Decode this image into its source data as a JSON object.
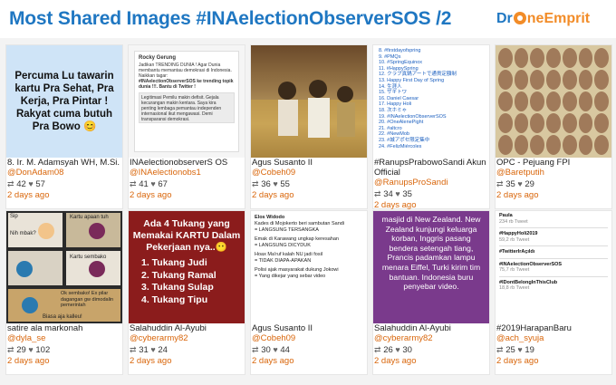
{
  "title": "Most Shared Images #INAelectionObserverSOS /2",
  "logo": {
    "pre": "Dr",
    "post": "neEmprit"
  },
  "items": [
    {
      "name": "8. Ir. M. Adamsyah WH, M.Si.",
      "handle": "@DonAdam08",
      "retweets": "42",
      "likes": "57",
      "ago": "2 days ago",
      "image_text": "Percuma Lu tawarin kartu Pra Sehat, Pra Kerja, Pra Pintar ! Rakyat cuma butuh Pra Bowo 😊"
    },
    {
      "name": "INAelectionobserverS OS",
      "handle": "@INAelectionobs1",
      "retweets": "41",
      "likes": "67",
      "ago": "2 days ago",
      "image_lines": [
        "Rocky Gerung",
        "Jadikan TRENDING DUNIA ! Agar Dunia membantu memantau demokrasi di Indonesia. Naikkan tagar:",
        "#INAelectionObserverSOS ke trending topik dunia !!!. Bantu di Twitter !",
        "Legitimasi Pemilu makin defisit. Gejala kecurangan makin kentara. Saya kira penting lembaga pemantau independen internasional ikut mengawasi. Demi transparansi demokrasi."
      ]
    },
    {
      "name": "Agus Susanto II",
      "handle": "@Cobeh09",
      "retweets": "36",
      "likes": "55",
      "ago": "2 days ago"
    },
    {
      "name": "#RanupsPrabowoSandi Akun",
      "name2": "Official",
      "handle": "@RanupsProSandi",
      "retweets": "34",
      "likes": "35",
      "ago": "2 days ago",
      "image_lines": [
        "8. #firstdayofspring",
        "9. #PMQs",
        "10. #SpringEquinox",
        "11. #HappySpring",
        "12. クラブ真鍋アートで通貨定額制",
        "13. Happy First Day of Spring",
        "14. 生涯人",
        "15. ザギトワ",
        "16. Daniel Caesar",
        "17. Happy Holi",
        "18. 次ホミゃ",
        "19. #INAelectionObserverSOS",
        "20. #OneAlenePight",
        "21. #altcro",
        "22. #NewMob",
        "23. #城アポセ限定集中",
        "24. #FelizMiércoles"
      ]
    },
    {
      "name": "OPC - Pejuang FPI",
      "handle": "@Baretputih",
      "retweets": "35",
      "likes": "29",
      "ago": "2 days ago"
    },
    {
      "name": "satire ala markonah",
      "handle": "@dyla_se",
      "retweets": "29",
      "likes": "102",
      "ago": "2 days ago",
      "image_lines": [
        "Sip",
        "Nih mbak?",
        "Kartu apaan tuh",
        "Kartu sembako",
        "Ok sembako! Ex pilar dagangan gw dimodalin pemerintah",
        "Biasa aja kalleu!"
      ]
    },
    {
      "name": "Salahuddin Al-Ayubi",
      "handle": "@cyberarmy82",
      "retweets": "31",
      "likes": "24",
      "ago": "2 days ago",
      "image_title": "Ada 4 Tukang yang Memakai KARTU Dalam Pekerjaan nya..😶",
      "image_lines": [
        "1. Tukang Judi",
        "2. Tukang Ramal",
        "3. Tukang Sulap",
        "4. Tukang Tipu"
      ]
    },
    {
      "name": "Agus Susanto II",
      "handle": "@Cobeh09",
      "retweets": "30",
      "likes": "44",
      "ago": "2 days ago",
      "image_lines": [
        "Elos Widodo",
        "Kades di Mojokerto beri sambutan Sandi",
        "= LANGSUNG TERSANGKA",
        "Emak di Karawang ungkap keresahan",
        "= LANGSUNG DICYDUK",
        "Hoax Ma'ruf kalah NU jadi fosil",
        "= TIDAK DIAPA-APAKAN",
        "Polisi ajak masyarakat dukung Jokowi",
        "= Yang dikejar yang sebar video"
      ]
    },
    {
      "name": "Salahuddin Al-Ayubi",
      "handle": "@cyberarmy82",
      "retweets": "26",
      "likes": "30",
      "ago": "2 days ago",
      "image_text": "masjid di New Zealand. New Zealand kunjungi keluarga korban, Inggris pasang bendera setengah tiang, Prancis padamkan lampu menara Eiffel, Turki kirim tim bantuan. Indonesia buru penyebar video."
    },
    {
      "name": "#2019HarapanBaru",
      "handle": "@ach_syuja",
      "retweets": "25",
      "likes": "19",
      "ago": "2 days ago",
      "image_lines": [
        {
          "tag": "Paula",
          "sub": "234 rb Tweet"
        },
        {
          "tag": "#HappyHoli2019",
          "sub": "59,2 rb Tweet"
        },
        {
          "tag": "#TwitterIrAçıldı",
          "sub": ""
        },
        {
          "tag": "#INAelectionObserverSOS",
          "sub": "75,7 rb Tweet"
        },
        {
          "tag": "#IDontBelongInThisClub",
          "sub": "18,8 rb Tweet"
        }
      ]
    }
  ]
}
